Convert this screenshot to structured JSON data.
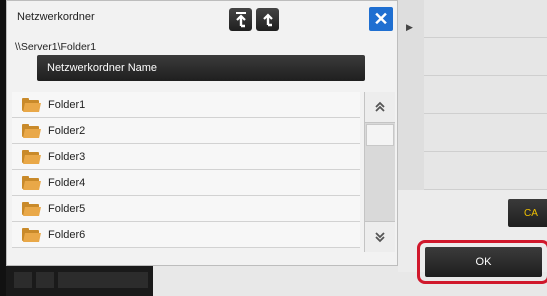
{
  "dialog": {
    "title": "Netzwerkordner",
    "path": "\\\\Server1\\Folder1",
    "column_header": "Netzwerkordner Name",
    "up_top_icon": "⮬",
    "up_icon": "t",
    "close_icon": "✕",
    "folders": [
      {
        "label": "Folder1"
      },
      {
        "label": "Folder2"
      },
      {
        "label": "Folder3"
      },
      {
        "label": "Folder4"
      },
      {
        "label": "Folder5"
      },
      {
        "label": "Folder6"
      }
    ],
    "scroll_up_icon": "⮝",
    "scroll_down_icon": "⮟"
  },
  "side": {
    "play_icon": "▶",
    "ca_label": "CA",
    "ok_label": "OK"
  },
  "colors": {
    "close_blue": "#1f6fd1",
    "ok_highlight": "#d0182c",
    "ca_text": "#f0c000",
    "folder": "#e9a848"
  }
}
